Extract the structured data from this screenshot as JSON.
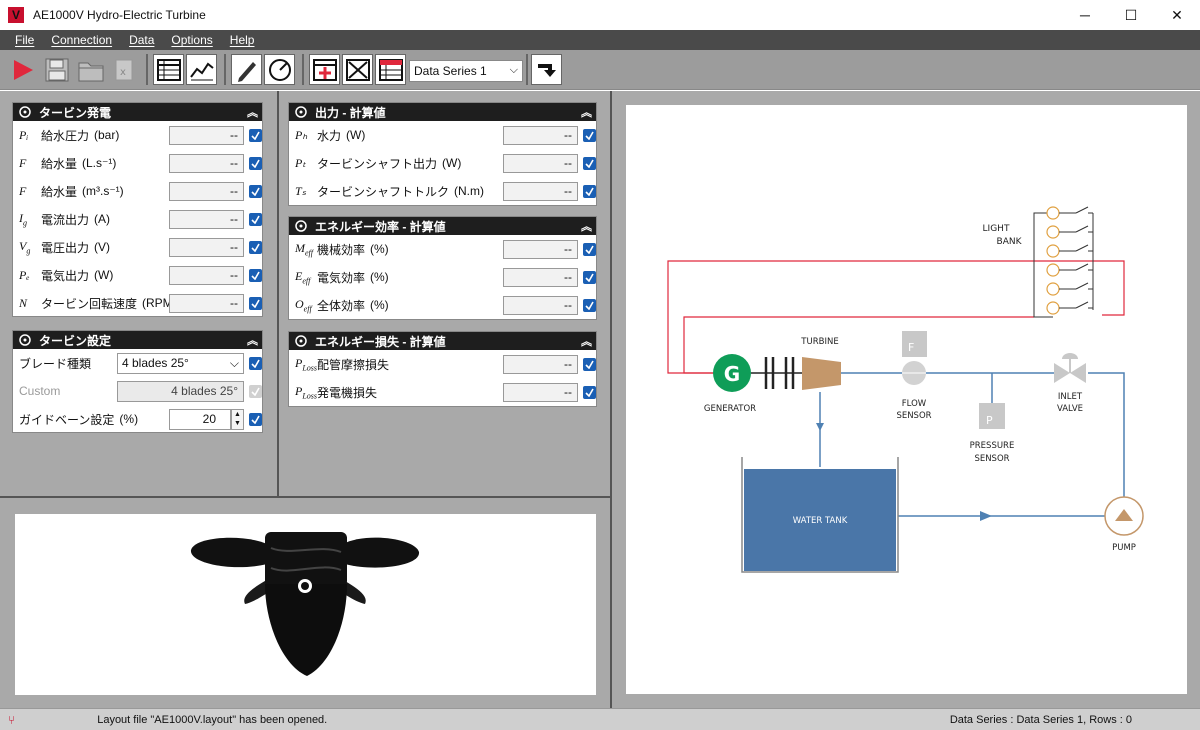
{
  "window": {
    "title": "AE1000V Hydro-Electric Turbine",
    "logo": "V",
    "minimize": "─",
    "maximize": "☐",
    "close": "✕"
  },
  "menu": [
    "File",
    "Connection",
    "Data",
    "Options",
    "Help"
  ],
  "toolbar": {
    "series_select": "Data Series 1"
  },
  "gen_panel": {
    "title": "タービン発電",
    "rows": [
      {
        "sym": "Pᵢ",
        "label": "給水圧力",
        "unit": "(bar)",
        "value": "--"
      },
      {
        "sym": "F",
        "label": "給水量",
        "unit": "(L.s⁻¹)",
        "value": "--"
      },
      {
        "sym": "F",
        "label": "給水量",
        "unit": "(m³.s⁻¹)",
        "value": "--"
      },
      {
        "sym": "I_g",
        "label": "電流出力",
        "unit": "(A)",
        "value": "--"
      },
      {
        "sym": "V_g",
        "label": "電圧出力",
        "unit": "(V)",
        "value": "--"
      },
      {
        "sym": "Pₑ",
        "label": "電気出力",
        "unit": "(W)",
        "value": "--"
      },
      {
        "sym": "N",
        "label": "タービン回転速度",
        "unit": "(RPM)",
        "value": "--"
      }
    ]
  },
  "settings_panel": {
    "title": "タービン設定",
    "blade_label": "ブレード種類",
    "blade_value": "4 blades 25°",
    "custom_label": "Custom",
    "custom_value": "4 blades 25°",
    "guide_label": "ガイドベーン設定",
    "guide_unit": "(%)",
    "guide_value": "20"
  },
  "output_panel": {
    "title": "出力 - 計算値",
    "rows": [
      {
        "sym": "Pₕ",
        "label": "水力",
        "unit": "(W)",
        "value": "--"
      },
      {
        "sym": "Pₜ",
        "label": "タービンシャフト出力",
        "unit": "(W)",
        "value": "--"
      },
      {
        "sym": "Tₛ",
        "label": "タービンシャフトトルク",
        "unit": "(N.m)",
        "value": "--"
      }
    ]
  },
  "efficiency_panel": {
    "title": "エネルギー効率 - 計算値",
    "rows": [
      {
        "sym": "M_eff",
        "label": "機械効率",
        "unit": "(%)",
        "value": "--"
      },
      {
        "sym": "E_eff",
        "label": "電気効率",
        "unit": "(%)",
        "value": "--"
      },
      {
        "sym": "O_eff",
        "label": "全体効率",
        "unit": "(%)",
        "value": "--"
      }
    ]
  },
  "loss_panel": {
    "title": "エネルギー損失 - 計算値",
    "rows": [
      {
        "sym": "P_Loss",
        "label": "配管摩擦損失",
        "value": "--"
      },
      {
        "sym": "P_Loss",
        "label": "発電機損失",
        "value": "--"
      }
    ]
  },
  "diagram": {
    "light_bank": [
      "LIGHT",
      "BANK"
    ],
    "turbine": "TURBINE",
    "generator": "GENERATOR",
    "gen_letter": "G",
    "flow_sensor": [
      "FLOW",
      "SENSOR"
    ],
    "flow_letter": "F",
    "pressure_sensor": [
      "PRESSURE",
      "SENSOR"
    ],
    "pressure_letter": "P",
    "inlet_valve": [
      "INLET",
      "VALVE"
    ],
    "water_tank": "WATER TANK",
    "pump": "PUMP",
    "colors": {
      "electric": "#e0283c",
      "water": "#4f81b3",
      "tank": "#4a76a8",
      "generator": "#0f9d58",
      "turbine": "#c4976a",
      "pump": "#c4976a"
    }
  },
  "status": {
    "message": "Layout file \"AE1000V.layout\" has been opened.",
    "series_info": "Data Series : Data Series 1,  Rows : 0"
  }
}
